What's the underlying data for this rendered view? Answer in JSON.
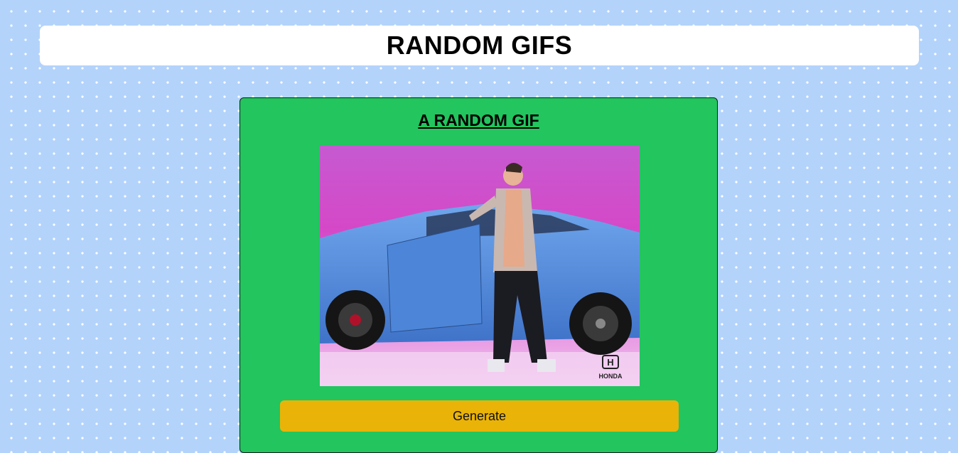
{
  "header": {
    "title": "RANDOM GIFS"
  },
  "card": {
    "title": "A RANDOM GIF",
    "gif_watermark": "HONDA",
    "generate_label": "Generate"
  },
  "colors": {
    "background": "#b3d3fb",
    "card": "#22c55e",
    "button": "#eab308"
  }
}
